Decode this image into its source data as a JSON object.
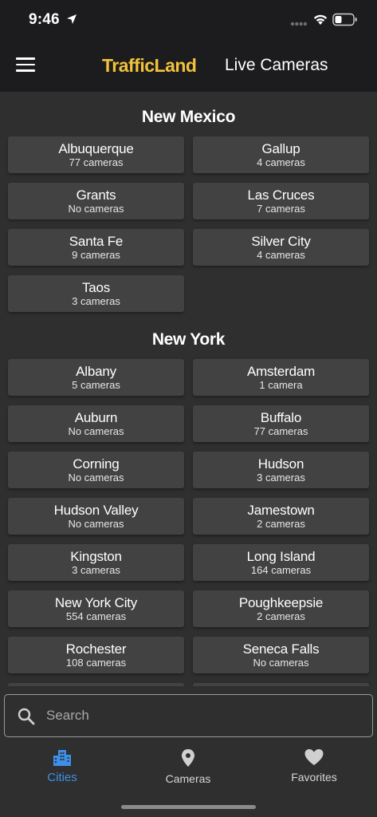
{
  "status": {
    "time": "9:46"
  },
  "nav": {
    "logo_text": "TrafficLand",
    "title": "Live Cameras"
  },
  "states": [
    {
      "name": "New Mexico",
      "cities": [
        {
          "name": "Albuquerque",
          "count": "77 cameras"
        },
        {
          "name": "Gallup",
          "count": "4 cameras"
        },
        {
          "name": "Grants",
          "count": "No cameras"
        },
        {
          "name": "Las Cruces",
          "count": "7 cameras"
        },
        {
          "name": "Santa Fe",
          "count": "9 cameras"
        },
        {
          "name": "Silver City",
          "count": "4 cameras"
        },
        {
          "name": "Taos",
          "count": "3 cameras"
        }
      ]
    },
    {
      "name": "New York",
      "cities": [
        {
          "name": "Albany",
          "count": "5 cameras"
        },
        {
          "name": "Amsterdam",
          "count": "1 camera"
        },
        {
          "name": "Auburn",
          "count": "No cameras"
        },
        {
          "name": "Buffalo",
          "count": "77 cameras"
        },
        {
          "name": "Corning",
          "count": "No cameras"
        },
        {
          "name": "Hudson",
          "count": "3 cameras"
        },
        {
          "name": "Hudson Valley",
          "count": "No cameras"
        },
        {
          "name": "Jamestown",
          "count": "2 cameras"
        },
        {
          "name": "Kingston",
          "count": "3 cameras"
        },
        {
          "name": "Long Island",
          "count": "164 cameras"
        },
        {
          "name": "New York City",
          "count": "554 cameras"
        },
        {
          "name": "Poughkeepsie",
          "count": "2 cameras"
        },
        {
          "name": "Rochester",
          "count": "108 cameras"
        },
        {
          "name": "Seneca Falls",
          "count": "No cameras"
        }
      ]
    }
  ],
  "search": {
    "placeholder": "Search"
  },
  "tabs": [
    {
      "label": "Cities",
      "icon": "city-icon",
      "active": true
    },
    {
      "label": "Cameras",
      "icon": "map-pin-icon",
      "active": false
    },
    {
      "label": "Favorites",
      "icon": "heart-icon",
      "active": false
    }
  ],
  "colors": {
    "accent": "#3d8fe8",
    "logo_yellow": "#f2c23a",
    "card": "#424242",
    "background": "#2f2f2f",
    "bar": "#1c1c1e"
  }
}
